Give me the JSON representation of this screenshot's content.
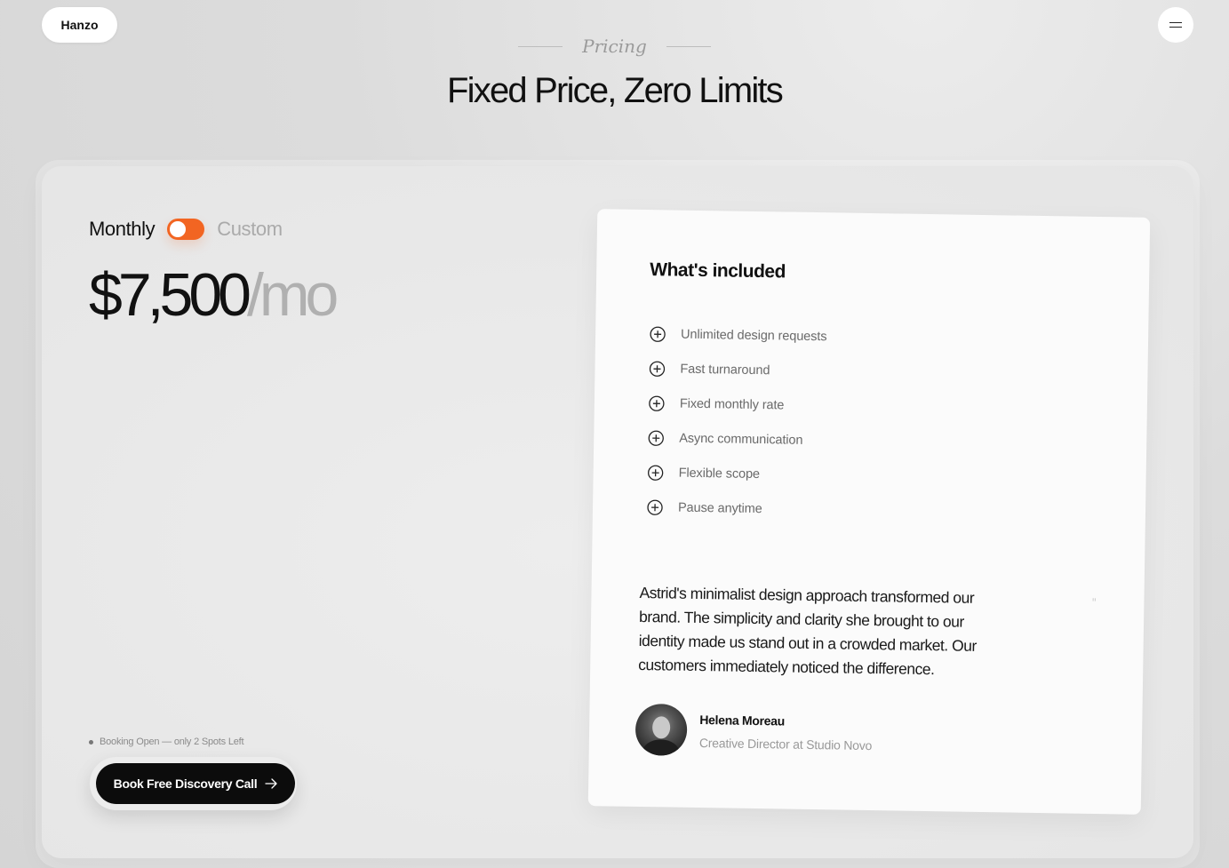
{
  "header": {
    "logo": "Hanzo",
    "menu_icon": "hamburger-menu-icon"
  },
  "section": {
    "eyebrow": "Pricing",
    "title": "Fixed Price, Zero Limits"
  },
  "pricing": {
    "toggle_left": "Monthly",
    "toggle_right": "Custom",
    "toggle_state": "on",
    "toggle_color": "#f26522",
    "amount": "$7,500",
    "period": "/mo",
    "availability": "Booking Open — only 2 Spots Left",
    "cta_label": "Book Free Discovery Call",
    "cta_icon": "arrow-right-icon"
  },
  "included": {
    "title": "What's included",
    "feature_icon": "plus-circle-icon",
    "features": [
      "Unlimited design requests",
      "Fast turnaround",
      "Fixed monthly rate",
      "Async communication",
      "Flexible scope",
      "Pause anytime"
    ]
  },
  "testimonial": {
    "quote_mark": "\"",
    "quote": "Astrid's minimalist design approach transformed our brand. The simplicity and clarity she brought to our identity made us stand out in a crowded market. Our customers immediately noticed the difference.",
    "author_name": "Helena Moreau",
    "author_role": "Creative Director at Studio Novo"
  }
}
